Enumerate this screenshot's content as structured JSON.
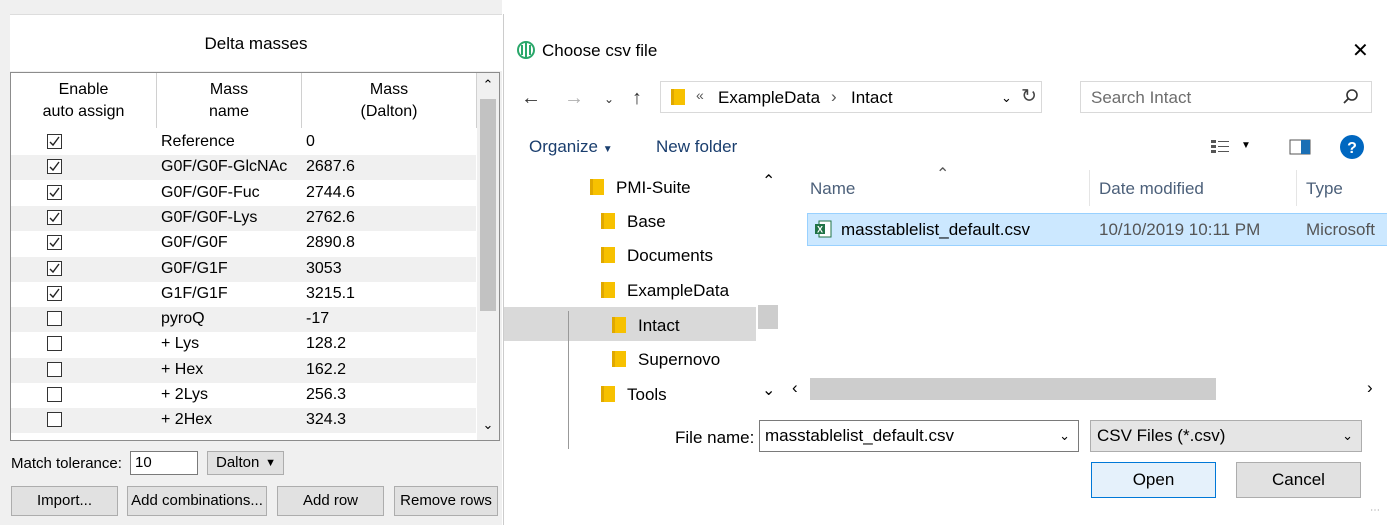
{
  "left": {
    "title": "Delta masses",
    "headers": {
      "enable": "Enable\nauto assign",
      "name": "Mass\nname",
      "mass": "Mass\n(Dalton)"
    },
    "rows": [
      {
        "checked": true,
        "name": "Reference",
        "mass": "0"
      },
      {
        "checked": true,
        "name": "G0F/G0F-GlcNAc",
        "mass": "2687.6"
      },
      {
        "checked": true,
        "name": "G0F/G0F-Fuc",
        "mass": "2744.6"
      },
      {
        "checked": true,
        "name": "G0F/G0F-Lys",
        "mass": "2762.6"
      },
      {
        "checked": true,
        "name": "G0F/G0F",
        "mass": "2890.8"
      },
      {
        "checked": true,
        "name": "G0F/G1F",
        "mass": "3053"
      },
      {
        "checked": true,
        "name": "G1F/G1F",
        "mass": "3215.1"
      },
      {
        "checked": false,
        "name": "pyroQ",
        "mass": "-17"
      },
      {
        "checked": false,
        "name": "+ Lys",
        "mass": "128.2"
      },
      {
        "checked": false,
        "name": "+ Hex",
        "mass": "162.2"
      },
      {
        "checked": false,
        "name": "+ 2Lys",
        "mass": "256.3"
      },
      {
        "checked": false,
        "name": "+ 2Hex",
        "mass": "324.3"
      }
    ],
    "match_tolerance_label": "Match tolerance:",
    "match_tolerance_value": "10",
    "unit": "Dalton",
    "buttons": {
      "import": "Import...",
      "add_combinations": "Add combinations...",
      "add_row": "Add row",
      "remove_rows": "Remove rows"
    }
  },
  "dialog": {
    "title": "Choose csv file",
    "breadcrumb": [
      "ExampleData",
      "Intact"
    ],
    "search_placeholder": "Search Intact",
    "organize": "Organize",
    "new_folder": "New folder",
    "tree": [
      "PMI-Suite",
      "Base",
      "Documents",
      "ExampleData",
      "Intact",
      "Supernovo",
      "Tools"
    ],
    "selected_folder": "Intact",
    "columns": {
      "name": "Name",
      "date": "Date modified",
      "type": "Type"
    },
    "files": [
      {
        "name": "masstablelist_default.csv",
        "date": "10/10/2019 10:11 PM",
        "type": "Microsoft"
      }
    ],
    "file_name_label": "File name:",
    "file_name_value": "masstablelist_default.csv",
    "file_type": "CSV Files (*.csv)",
    "open_label": "Open",
    "cancel_label": "Cancel",
    "accent_color": "#0078d7",
    "help_color": "#0067c0"
  }
}
